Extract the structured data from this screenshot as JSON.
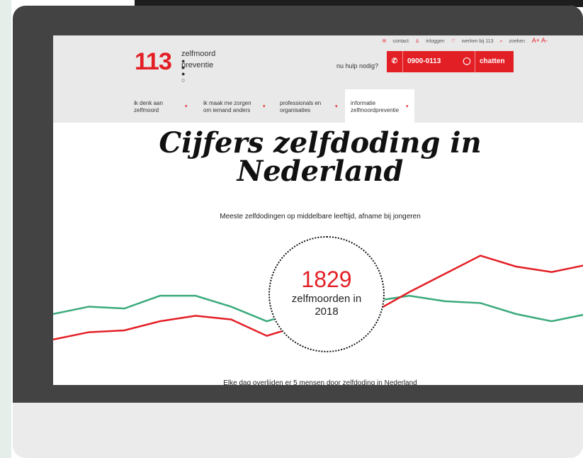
{
  "toplinks": {
    "contact": "contact",
    "login": "inloggen",
    "jobs": "werken bij 113",
    "search": "zoeken",
    "font_size": "A+ A-"
  },
  "logo": {
    "number": "113",
    "word1": "zelfmoord",
    "word2": "preventie"
  },
  "help": {
    "label": "nu hulp nodig?",
    "phone": "0900-0113",
    "chat": "chatten"
  },
  "nav": [
    {
      "label": "ik denk aan zelfmoord"
    },
    {
      "label": "ik maak me zorgen om iemand anders"
    },
    {
      "label": "professionals en organisaties"
    },
    {
      "label": "informatie zelfmoordpreventie"
    }
  ],
  "page": {
    "title_line1": "Cijfers zelfdoding in",
    "title_line2": "Nederland",
    "subtitle": "Meeste zelfdodingen op middelbare leeftijd, afname bij jongeren",
    "big_number": "1829",
    "caption_line1": "zelfmoorden in",
    "caption_line2": "2018",
    "bottom": "Elke dag overlijden er 5 mensen door zelfdoding in Nederland"
  },
  "chart_data": {
    "type": "line",
    "x": [
      0,
      1,
      2,
      3,
      4,
      5,
      6,
      7,
      8,
      9,
      10,
      11,
      12,
      13,
      14,
      15
    ],
    "series": [
      {
        "color": "#3aaa7b",
        "values": [
          70,
          74,
          73,
          80,
          80,
          74,
          66,
          72,
          68,
          77,
          80,
          77,
          76,
          70,
          66,
          70
        ]
      },
      {
        "color": "#e31f26",
        "values": [
          56,
          60,
          61,
          66,
          69,
          67,
          58,
          64,
          70,
          71,
          82,
          92,
          102,
          96,
          93,
          97
        ]
      }
    ],
    "ylim": [
      40,
      110
    ]
  }
}
